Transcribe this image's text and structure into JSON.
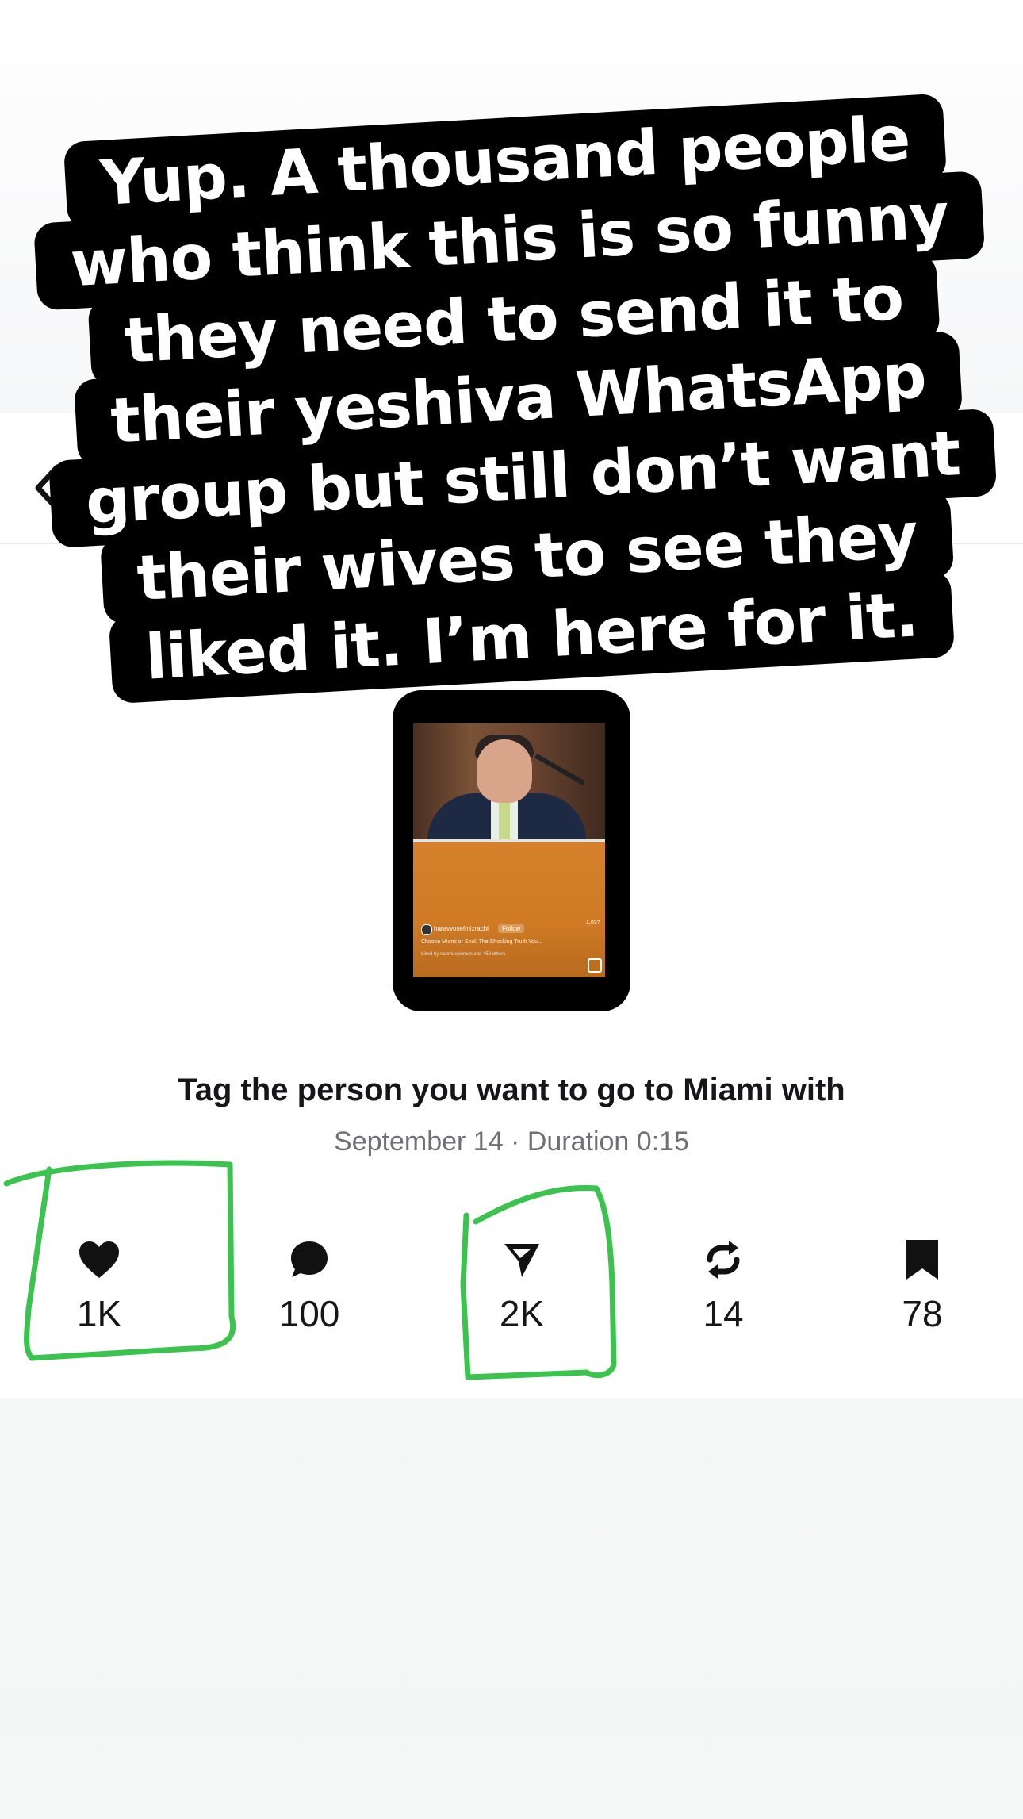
{
  "overlay_caption": {
    "lines": [
      "Yup. A thousand people",
      "who think this is so funny",
      "they need to send it to",
      "their yeshiva WhatsApp",
      "group but still don’t want",
      "their wives to see they",
      "liked it. I’m here for it."
    ]
  },
  "navigation": {
    "back_icon": "chevron-left-icon"
  },
  "video_preview": {
    "username": "haravyosefmizrachi",
    "follow_label": "Follow",
    "caption": "Choose Miami or Soul: The Shocking Truth You...",
    "liked_by": "Liked by naomi.coleman and 453 others",
    "side_count": "1,037"
  },
  "post": {
    "title": "Tag the person you want to go to Miami with",
    "meta": "September 14 · Duration 0:15"
  },
  "actions": [
    {
      "icon": "heart-icon",
      "count": "1K"
    },
    {
      "icon": "comment-icon",
      "count": "100"
    },
    {
      "icon": "send-icon",
      "count": "2K"
    },
    {
      "icon": "repost-icon",
      "count": "14"
    },
    {
      "icon": "bookmark-icon",
      "count": "78"
    }
  ],
  "colors": {
    "highlight": "#3cc24e",
    "text": "#16161a",
    "meta_text": "#6f6f76"
  }
}
